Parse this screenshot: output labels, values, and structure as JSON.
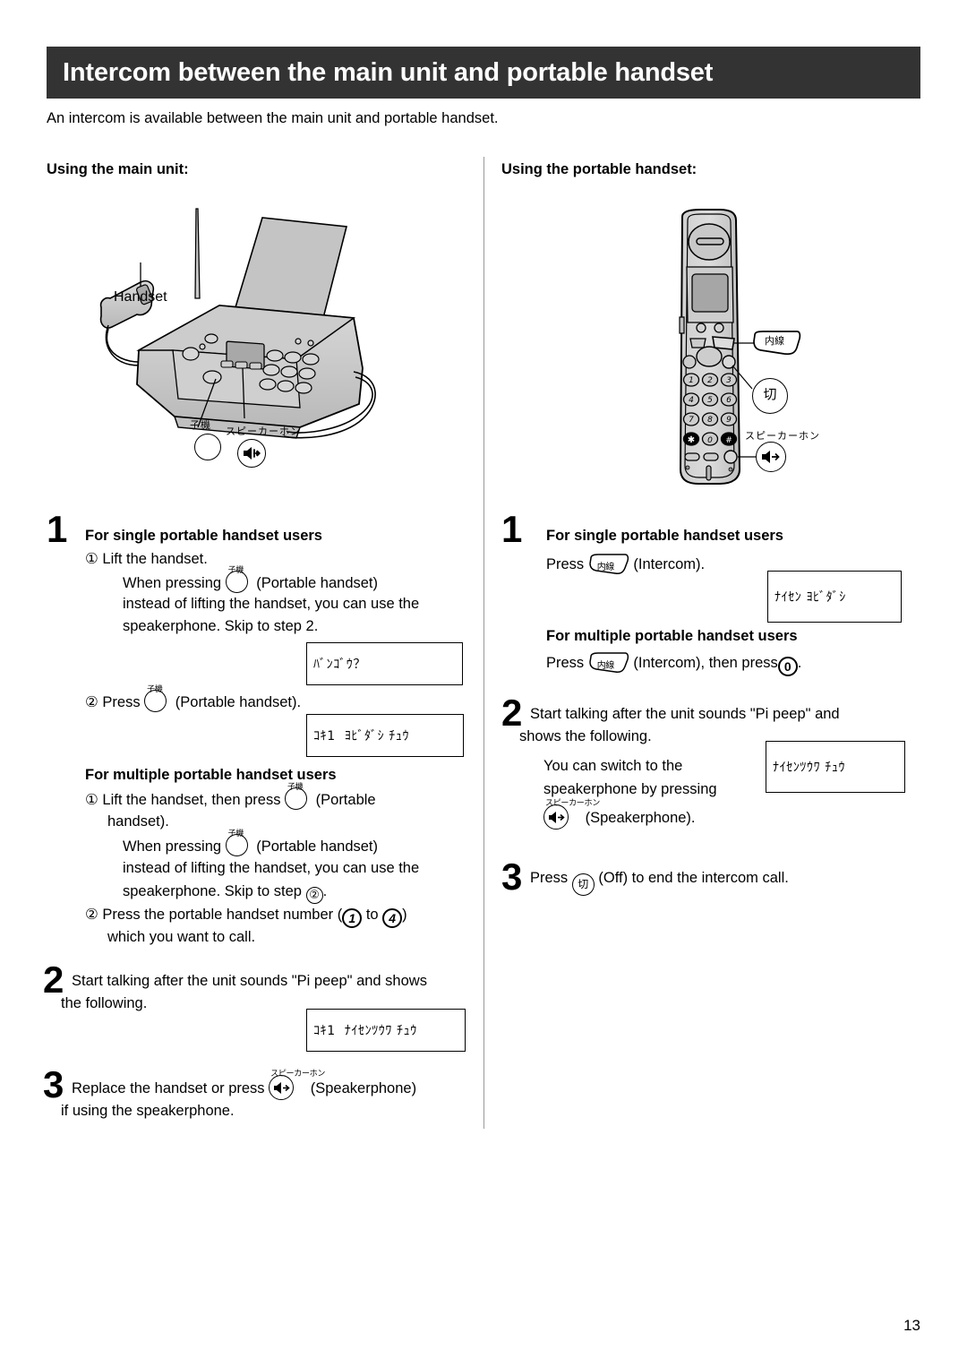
{
  "header": {
    "title": "Intercom between the main unit and portable handset",
    "intro": "An intercom is available between the main unit and portable handset."
  },
  "columns": {
    "left_heading": "Using the main unit:",
    "right_heading": "Using the portable handset:"
  },
  "figures": {
    "main_unit": {
      "handset_label": "Handset",
      "portable_button_label": "子機",
      "speakerphone_button_label": "スピーカーホン"
    },
    "portable_handset": {
      "intercom_button_label": "内線",
      "off_button_label": "切",
      "speakerphone_button_label": "スピーカーホン",
      "keypad": [
        "1",
        "2",
        "3",
        "4",
        "5",
        "6",
        "7",
        "8",
        "9",
        "*",
        "0",
        "#"
      ]
    }
  },
  "left_column": {
    "step1": {
      "number": "1",
      "single_heading": "For single portable handset users",
      "item1_marker": "①",
      "item1_line1": "Lift the handset.",
      "item1_line2a": "When pressing",
      "item1_rubi": "子機",
      "item1_line2b": "(Portable handset)",
      "item1_line3": "instead of lifting the handset, you can use the",
      "item1_line4": "speakerphone. Skip to step 2.",
      "lcd1": "ﾊﾞﾝｺﾞｳ？",
      "item2_marker": "②",
      "item2_a": "Press",
      "item2_rubi": "子機",
      "item2_b": "(Portable handset).",
      "lcd2": "ｺｷ1  ﾖﾋﾞﾀﾞｼ ﾁｭｳ",
      "multiple_heading": "For multiple portable handset users",
      "m_item1_marker": "①",
      "m_item1_a": "Lift the handset, then press",
      "m_item1_rubi": "子機",
      "m_item1_b": "(Portable",
      "m_item1_c": "handset).",
      "m_item1_d": "When pressing",
      "m_item1_rubi2": "子機",
      "m_item1_e": "(Portable handset)",
      "m_item1_f": "instead of lifting the handset, you can use the",
      "m_item1_g": "speakerphone. Skip to step",
      "m_item1_step": "②",
      "m_item1_h": ".",
      "m_item2_marker": "②",
      "m_item2_a": "Press the portable handset number (",
      "m_item2_num1": "1",
      "m_item2_to": "to",
      "m_item2_num2": "4",
      "m_item2_b": ")",
      "m_item2_c": "which you want to call."
    },
    "step2": {
      "number": "2",
      "line1": "Start talking after the unit sounds \"Pi peep\" and shows",
      "line2": "the following.",
      "lcd": "ｺｷ1  ﾅｲｾﾝﾂｳﾜ ﾁｭｳ"
    },
    "step3": {
      "number": "3",
      "line1a": "Replace the handset or press",
      "rubi": "スピーカーホン",
      "line1b": "(Speakerphone)",
      "line2": "if using the speakerphone."
    }
  },
  "right_column": {
    "step1": {
      "number": "1",
      "single_heading": "For single portable handset users",
      "press_a": "Press",
      "intercom_btn": "内線",
      "press_b": "(Intercom).",
      "lcd1": "ﾅｲｾﾝ ﾖﾋﾞﾀﾞｼ",
      "multiple_heading": "For multiple portable handset users",
      "press2_a": "Press",
      "press2_b": "(Intercom), then press",
      "press2_zero": "0",
      "press2_c": "."
    },
    "step2": {
      "number": "2",
      "line1": "Start talking after the unit sounds \"Pi peep\" and",
      "line2": "shows the following.",
      "line3": "You can switch to the",
      "line4": "speakerphone by pressing",
      "rubi": "スピーカーホン",
      "line5": "(Speakerphone).",
      "lcd": "ﾅｲｾﾝﾂｳﾜ ﾁｭｳ"
    },
    "step3": {
      "number": "3",
      "line_a": "Press",
      "off_btn": "切",
      "line_b": "(Off) to end the intercom call."
    }
  },
  "footer": {
    "page_number": "13"
  },
  "colors": {
    "title_bar": "#333333",
    "text": "#000000",
    "divider": "#9a9a9a"
  }
}
